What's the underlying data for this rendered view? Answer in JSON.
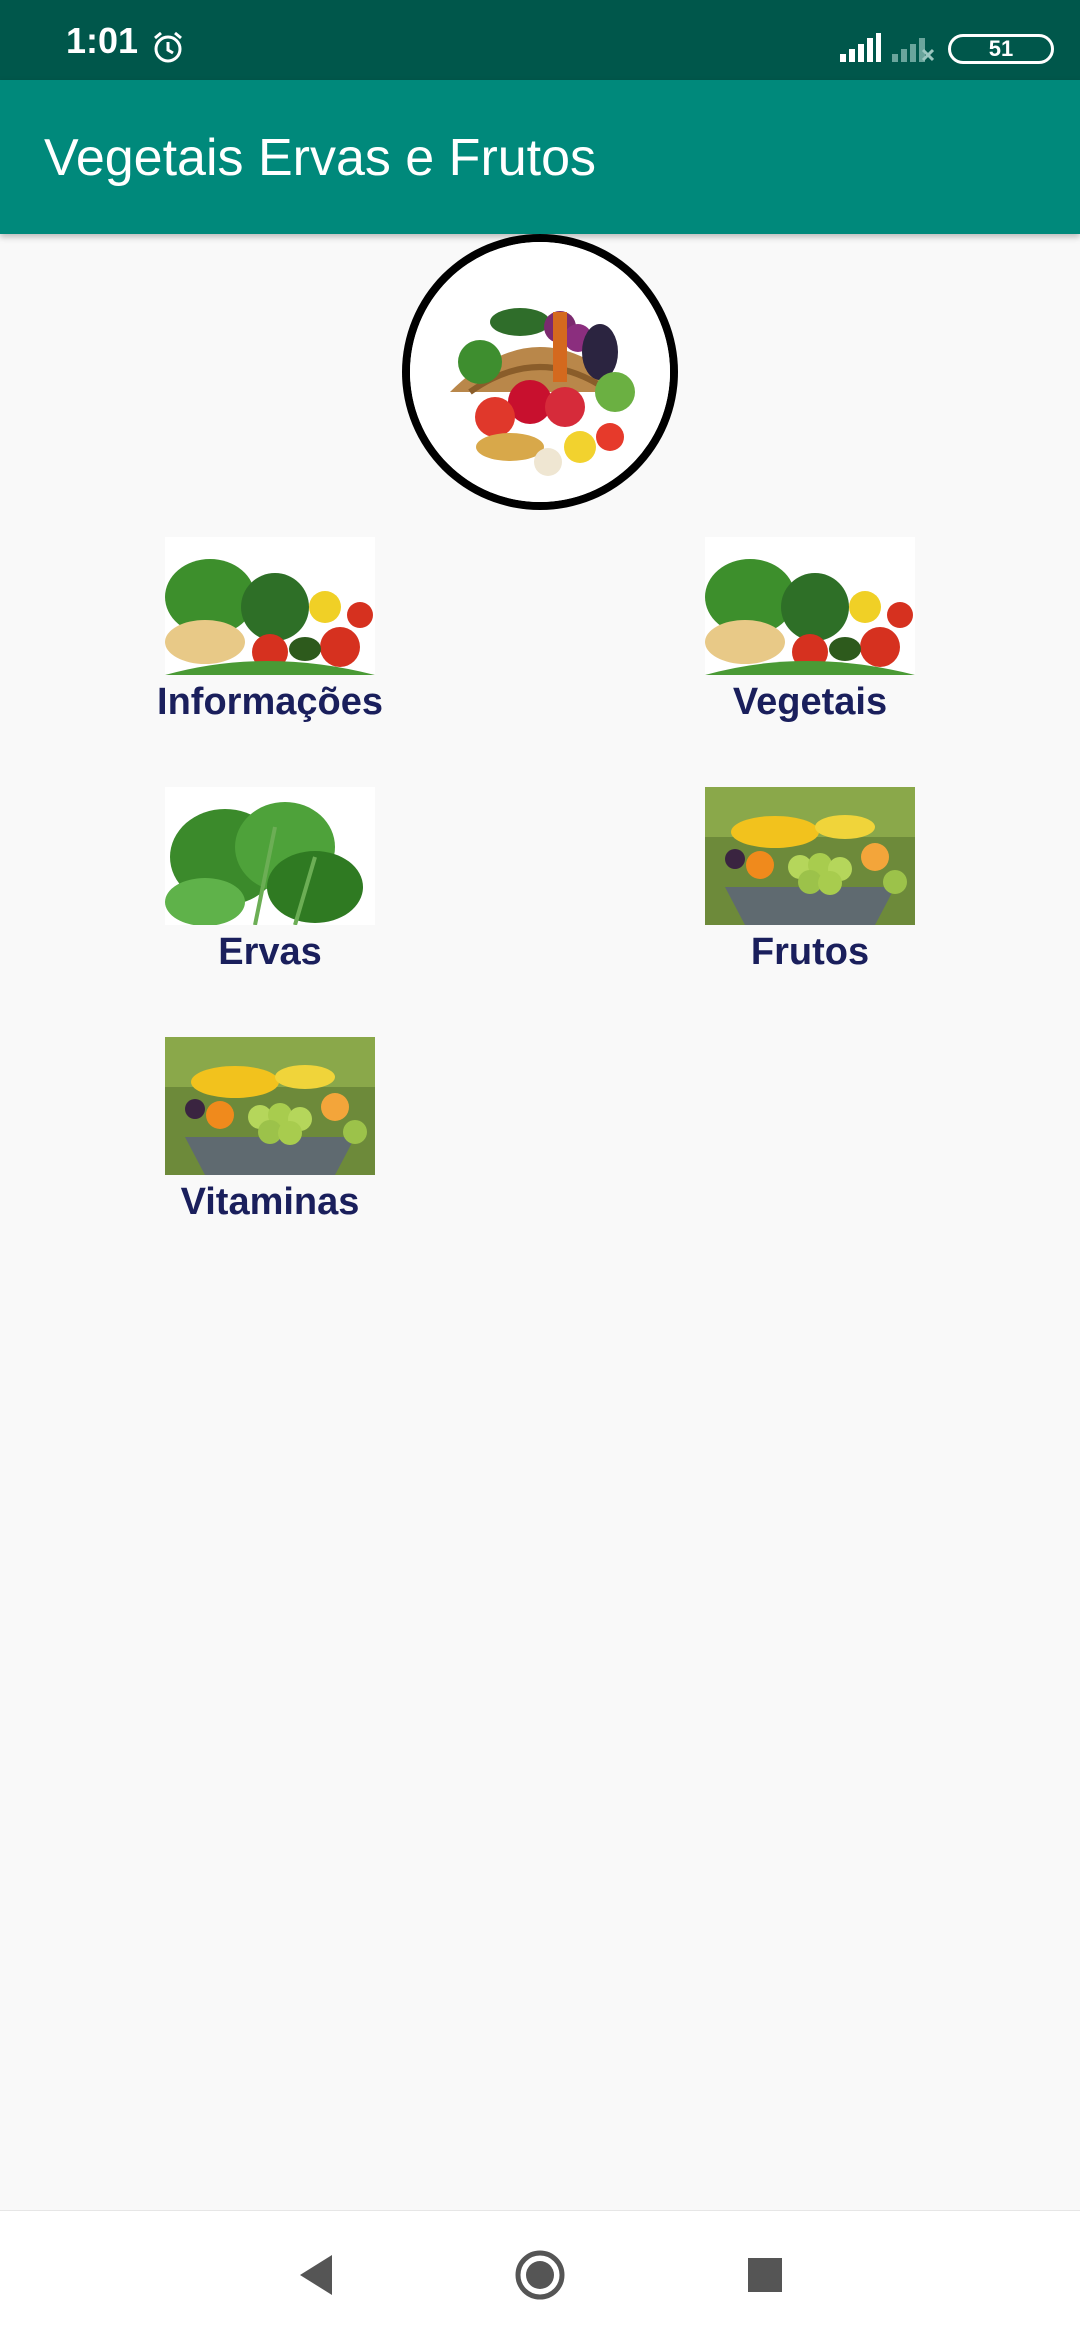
{
  "status_bar": {
    "time": "1:01",
    "battery": "51"
  },
  "app_bar": {
    "title": "Vegetais Ervas e Frutos"
  },
  "menu": {
    "items": [
      {
        "label": "Informações",
        "image": "vegetables-photo"
      },
      {
        "label": "Vegetais",
        "image": "vegetables-photo"
      },
      {
        "label": "Ervas",
        "image": "herbs-photo"
      },
      {
        "label": "Frutos",
        "image": "fruits-photo"
      },
      {
        "label": "Vitaminas",
        "image": "fruits-photo"
      }
    ]
  },
  "nav_bar": {
    "icons": [
      "back-icon",
      "home-icon",
      "recents-icon"
    ]
  },
  "colors": {
    "status_bar": "#00574b",
    "app_bar": "#00897b",
    "label": "#1a1f5c",
    "background": "#f9f9f9"
  }
}
